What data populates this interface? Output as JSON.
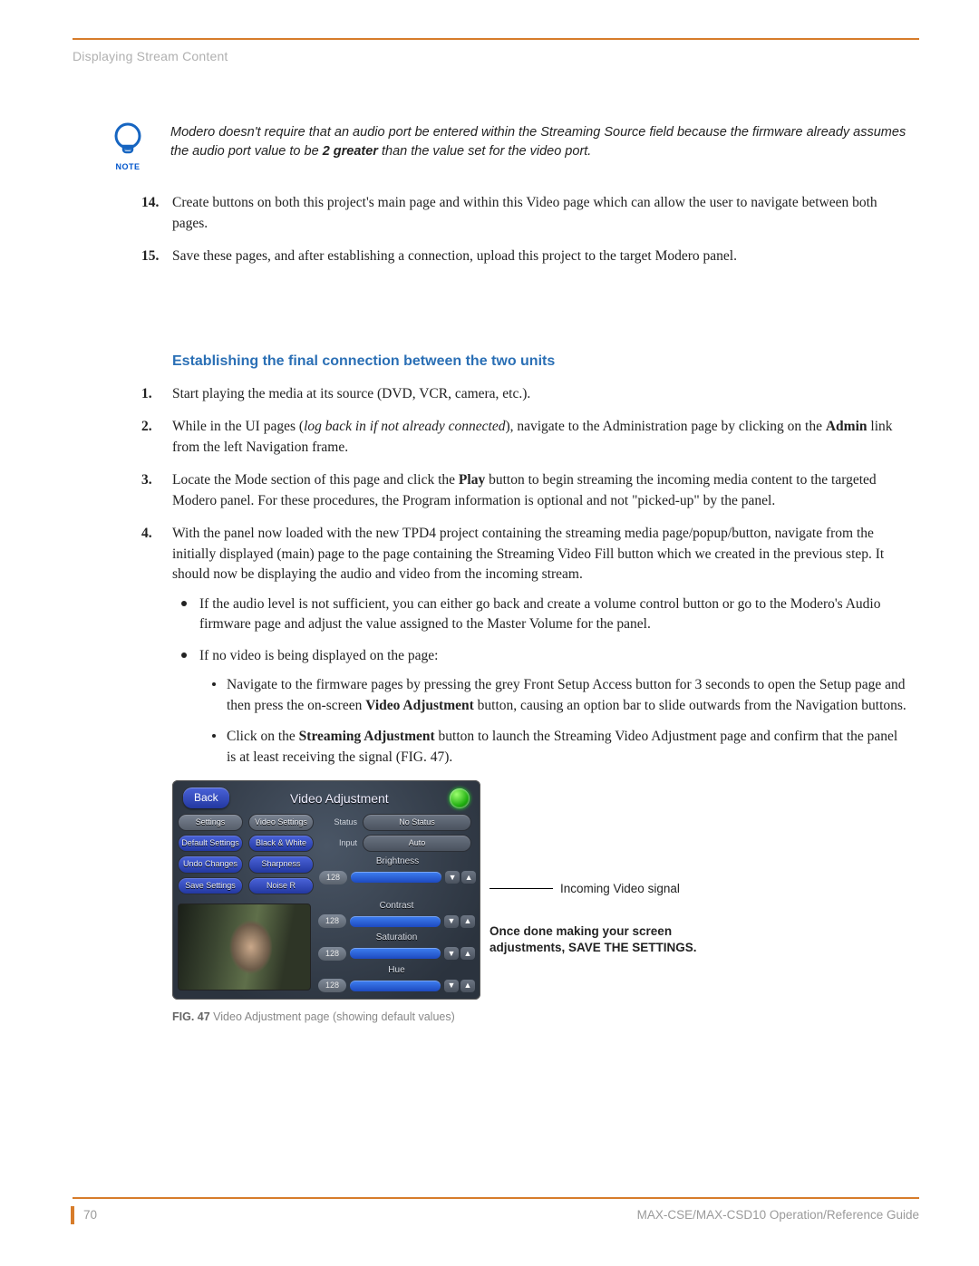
{
  "header": {
    "section": "Displaying Stream Content"
  },
  "note": {
    "label": "NOTE",
    "text_pre": "Modero doesn't require that an audio port be entered within the Streaming Source field because the firmware already assumes the audio port value to be ",
    "text_bold": "2 greater",
    "text_post": " than the value set for the video port."
  },
  "steps_a": [
    "Create buttons on both this project's main page and within this Video page which can allow the user to navigate between both pages.",
    "Save these pages, and after establishing a connection, upload this project to the target Modero panel."
  ],
  "section_heading": "Establishing the final connection between the two units",
  "steps_b": {
    "s1": "Start playing the media at its source (DVD, VCR, camera, etc.).",
    "s2_pre": "While in the UI pages (",
    "s2_em": "log back in if not already connected",
    "s2_mid": "), navigate to the Administration page by clicking on the ",
    "s2_b": "Admin",
    "s2_post": " link from the left Navigation frame.",
    "s3_pre": "Locate the Mode section of this page and click the ",
    "s3_b": "Play",
    "s3_post": " button to begin streaming the incoming media content to the targeted Modero panel. For these procedures, the Program information is optional and not \"picked-up\" by the panel.",
    "s4": "With the panel now loaded with the new TPD4 project containing the streaming media page/popup/button, navigate from the initially displayed (main) page to the page containing the Streaming Video Fill button which we created in the previous step. It should now be displaying the audio and video from the incoming stream."
  },
  "bullets": {
    "b1": "If the audio level is not sufficient, you can either go back and create a volume control button or go to the Modero's Audio firmware page and adjust the value assigned to the Master Volume for the panel.",
    "b2": "If no video is being displayed on the page:"
  },
  "subbullets": {
    "sb1_pre": "Navigate to the firmware pages by pressing the grey Front Setup Access button for 3 seconds to open the Setup page and then press the on-screen ",
    "sb1_b": "Video Adjustment",
    "sb1_post": " button, causing an option bar to slide outwards from the Navigation buttons.",
    "sb2_pre": "Click on the ",
    "sb2_b": "Streaming Adjustment",
    "sb2_post": " button to launch the Streaming Video Adjustment page and confirm that the panel is at least receiving the signal (FIG. 47)."
  },
  "figure": {
    "back": "Back",
    "title": "Video Adjustment",
    "col_settings": "Settings",
    "btn_default": "Default Settings",
    "btn_undo": "Undo Changes",
    "btn_save": "Save Settings",
    "col_video": "Video Settings",
    "btn_bw": "Black & White",
    "btn_sharp": "Sharpness",
    "btn_nr": "Noise R",
    "k_status": "Status",
    "v_status": "No Status",
    "k_input": "Input",
    "v_input": "Auto",
    "sliders": [
      {
        "label": "Brightness",
        "value": "128"
      },
      {
        "label": "Contrast",
        "value": "128"
      },
      {
        "label": "Saturation",
        "value": "128"
      },
      {
        "label": "Hue",
        "value": "128"
      }
    ],
    "callout1": "Incoming Video signal",
    "callout2": "Once done making your screen adjustments, SAVE THE SETTINGS.",
    "caption_b": "FIG. 47",
    "caption_rest": "  Video Adjustment page (showing default values)"
  },
  "footer": {
    "page": "70",
    "doc": "MAX-CSE/MAX-CSD10 Operation/Reference Guide"
  }
}
